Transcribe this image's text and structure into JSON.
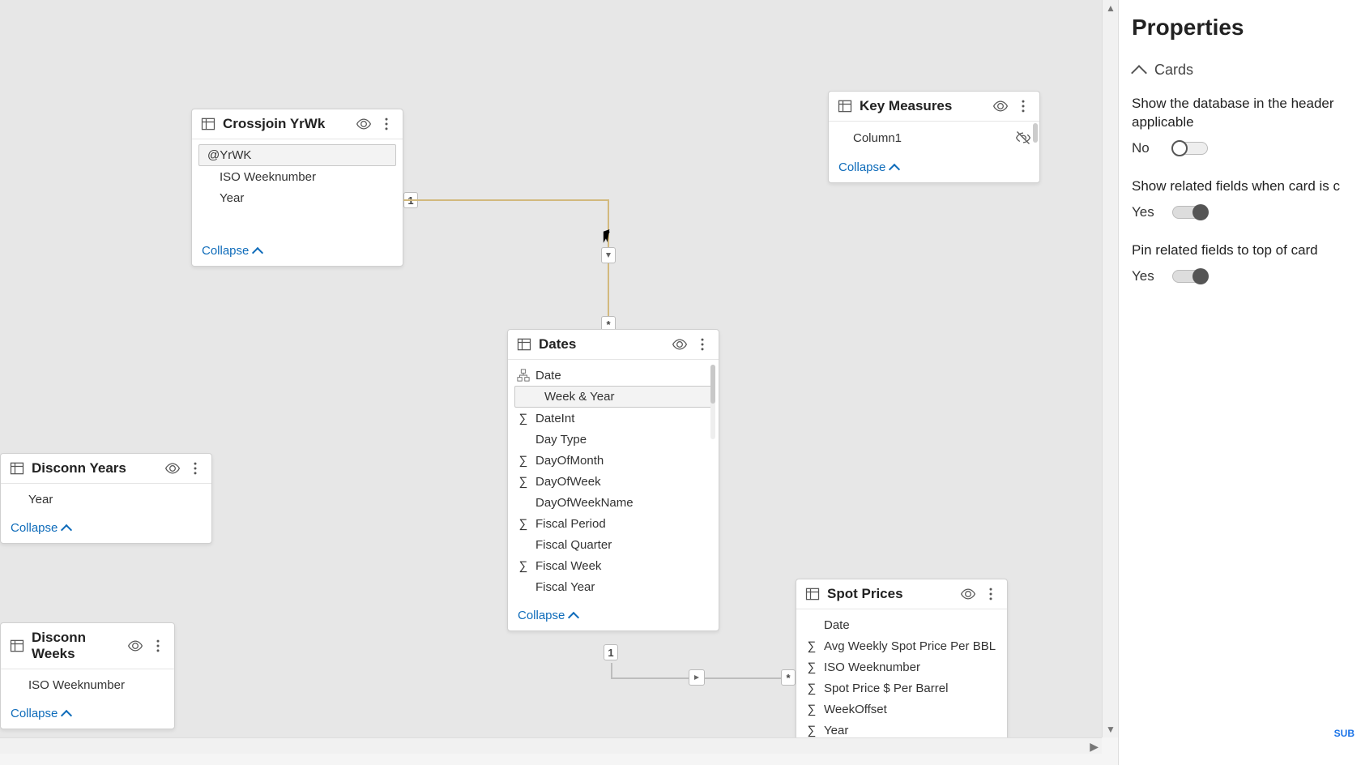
{
  "properties": {
    "title": "Properties",
    "section": "Cards",
    "items": [
      {
        "label": "Show the database in the header applicable",
        "state": "No",
        "on": false
      },
      {
        "label": "Show related fields when card is c",
        "state": "Yes",
        "on": true
      },
      {
        "label": "Pin related fields to top of card",
        "state": "Yes",
        "on": true
      }
    ]
  },
  "tables": {
    "crossjoin": {
      "title": "Crossjoin YrWk",
      "collapse": "Collapse",
      "fields": [
        {
          "label": "@YrWK",
          "selected": true
        },
        {
          "label": "ISO Weeknumber"
        },
        {
          "label": "Year"
        }
      ]
    },
    "keymeasures": {
      "title": "Key Measures",
      "collapse": "Collapse",
      "fields": [
        {
          "label": "Column1",
          "hidden": true
        }
      ]
    },
    "dates": {
      "title": "Dates",
      "collapse": "Collapse",
      "fields": [
        {
          "label": "Date",
          "icon": "hierarchy"
        },
        {
          "label": "Week & Year",
          "sub": true,
          "selected": true
        },
        {
          "label": "DateInt",
          "icon": "sigma"
        },
        {
          "label": "Day Type"
        },
        {
          "label": "DayOfMonth",
          "icon": "sigma"
        },
        {
          "label": "DayOfWeek",
          "icon": "sigma"
        },
        {
          "label": "DayOfWeekName"
        },
        {
          "label": "Fiscal Period",
          "icon": "sigma"
        },
        {
          "label": "Fiscal Quarter"
        },
        {
          "label": "Fiscal Week",
          "icon": "sigma"
        },
        {
          "label": "Fiscal Year"
        }
      ]
    },
    "spot": {
      "title": "Spot Prices",
      "fields": [
        {
          "label": "Date"
        },
        {
          "label": "Avg Weekly Spot Price Per BBL",
          "icon": "sigma"
        },
        {
          "label": "ISO Weeknumber",
          "icon": "sigma"
        },
        {
          "label": "Spot Price $ Per Barrel",
          "icon": "sigma"
        },
        {
          "label": "WeekOffset",
          "icon": "sigma"
        },
        {
          "label": "Year",
          "icon": "sigma"
        }
      ]
    },
    "disconnyears": {
      "title": "Disconn Years",
      "collapse": "Collapse",
      "fields": [
        {
          "label": "Year"
        }
      ]
    },
    "disconnweeks": {
      "title": "Disconn Weeks",
      "collapse": "Collapse",
      "fields": [
        {
          "label": "ISO Weeknumber"
        }
      ]
    }
  },
  "rel": {
    "one": "1",
    "many": "*"
  },
  "sub_badge": "SUB"
}
